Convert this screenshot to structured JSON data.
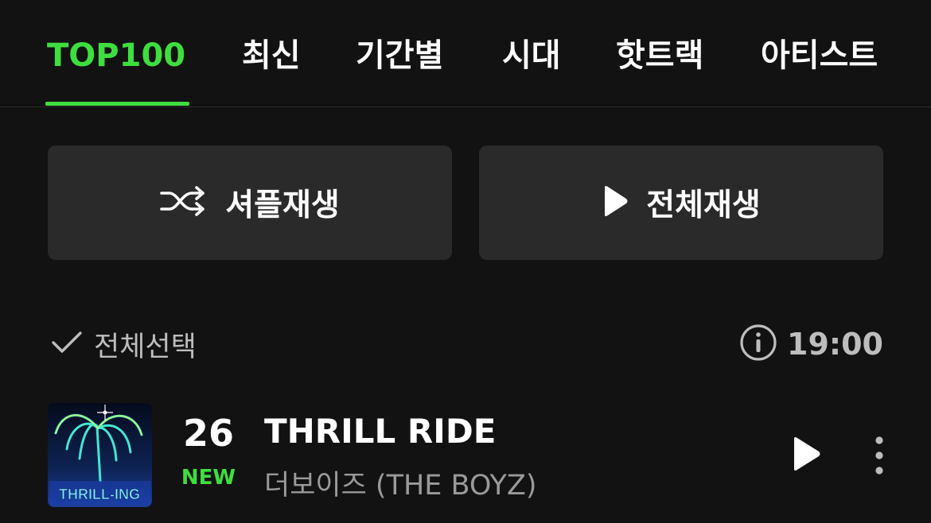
{
  "tabs": [
    {
      "label": "TOP100",
      "active": true
    },
    {
      "label": "최신"
    },
    {
      "label": "기간별"
    },
    {
      "label": "시대"
    },
    {
      "label": "핫트랙"
    },
    {
      "label": "아티스트"
    }
  ],
  "actions": {
    "shuffle_label": "셔플재생",
    "shuffle_icon": "shuffle-icon",
    "play_all_label": "전체재생",
    "play_all_icon": "play-icon"
  },
  "list_header": {
    "select_all_label": "전체선택",
    "select_all_icon": "check-icon",
    "info_icon": "info-icon",
    "update_time": "19:00"
  },
  "songs": [
    {
      "rank": "26",
      "rank_change": "NEW",
      "title": "THRILL RIDE",
      "artist": "더보이즈 (THE BOYZ)",
      "album_art_text": "THRILL-ING"
    }
  ],
  "colors": {
    "accent": "#3ede3e",
    "background": "#121212",
    "button_bg": "#2a2a2a",
    "secondary_text": "#9a9a9a"
  }
}
